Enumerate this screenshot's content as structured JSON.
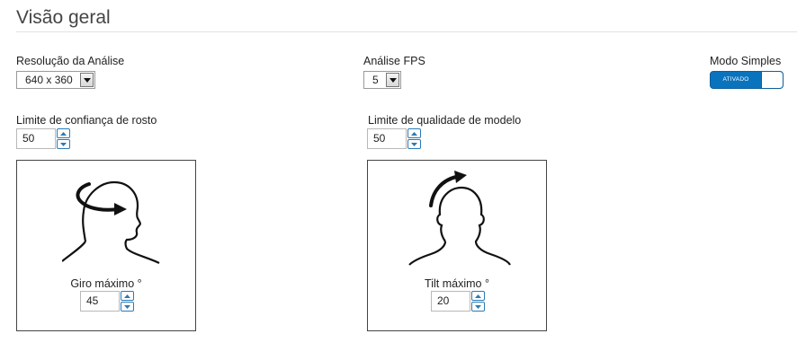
{
  "page": {
    "title": "Visão geral"
  },
  "resolution": {
    "label": "Resolução da Análise",
    "value": "640 x 360"
  },
  "fps": {
    "label": "Análise FPS",
    "value": "5"
  },
  "simple_mode": {
    "label": "Modo Simples",
    "state_text": "ATIVADO"
  },
  "face_confidence": {
    "label": "Limite de confiança de rosto",
    "value": "50"
  },
  "model_quality": {
    "label": "Limite de qualidade de modelo",
    "value": "50"
  },
  "rotation": {
    "label": "Giro máximo °",
    "value": "45",
    "icon": "head-rotation-icon"
  },
  "tilt": {
    "label": "Tilt máximo °",
    "value": "20",
    "icon": "head-tilt-icon"
  },
  "colors": {
    "accent": "#0a73bd",
    "spinner_border": "#2a7ab5"
  }
}
